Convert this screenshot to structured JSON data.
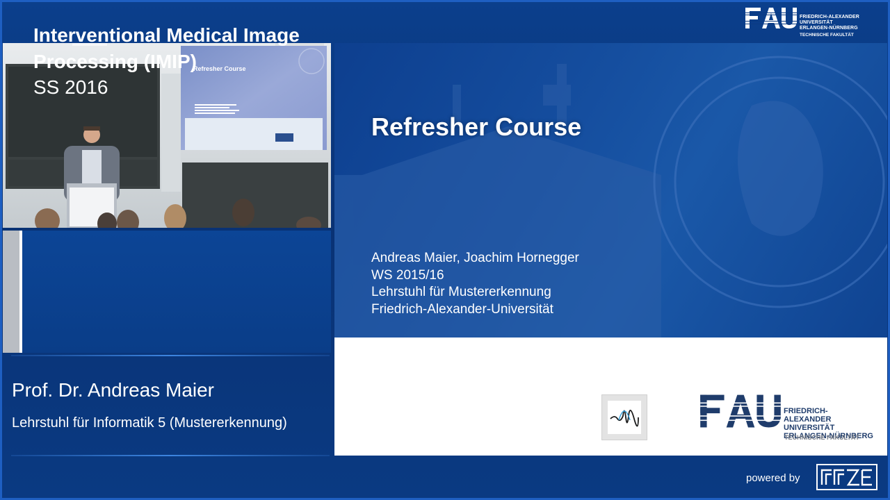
{
  "header": {
    "logo_text": "FAU",
    "university_line1": "FRIEDRICH-ALEXANDER",
    "university_line2": "UNIVERSITÄT",
    "university_line3": "ERLANGEN-NÜRNBERG",
    "faculty": "TECHNISCHE FAKULTÄT"
  },
  "course": {
    "title": "Interventional Medical Image Processing (IMIP)",
    "semester": "SS 2016"
  },
  "lecturer": {
    "name": "Prof. Dr. Andreas Maier",
    "chair": "Lehrstuhl für Informatik 5 (Mustererkennung)"
  },
  "slide": {
    "title": "Refresher Course",
    "authors": "Andreas Maier, Joachim Hornegger",
    "term": "WS 2015/16",
    "chair": "Lehrstuhl für Mustererkennung",
    "university": "Friedrich-Alexander-Universität",
    "logo_text": "FAU",
    "logo_line1": "FRIEDRICH-ALEXANDER",
    "logo_line2": "UNIVERSITÄT",
    "logo_line3": "ERLANGEN-NÜRNBERG",
    "logo_faculty": "TECHNISCHE FAKULTÄT"
  },
  "video": {
    "projected_title": "Refresher Course"
  },
  "footer": {
    "powered_by": "powered by",
    "provider_logo": "RRZE"
  },
  "colors": {
    "background": "#0a3a82",
    "accent": "#1e5fc2",
    "slide_banner": "#154e9f"
  }
}
